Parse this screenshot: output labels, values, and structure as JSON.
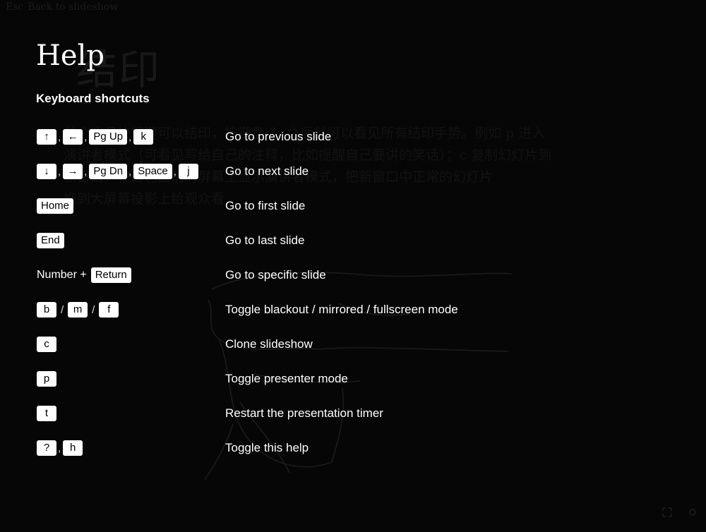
{
  "background": {
    "back_link": {
      "key": "Esc",
      "label": "Back to slideshow"
    },
    "slide_title": "结印",
    "slide_lines": [
      "单个字母快捷键可以结印，按键盘 ？ 之后就可以看见所有结印手势。例如 p 进入",
      "演讲者模式（可看见写给自己的注释，比如提醒自己要讲的笑话）；c 复制幻灯片到",
      "新窗口，在自己面前的屏幕上显示演讲者模式，把新窗口中正常的幻灯片",
      "拖到大屏幕投影上给观众看"
    ]
  },
  "help": {
    "title": "Help",
    "section_heading": "Keyboard shortcuts",
    "shortcuts": [
      {
        "keys": [
          "↑",
          "←",
          "Pg Up",
          "k"
        ],
        "description": "Go to previous slide"
      },
      {
        "keys": [
          "↓",
          "→",
          "Pg Dn",
          "Space",
          "j"
        ],
        "description": "Go to next slide"
      },
      {
        "keys": [
          "Home"
        ],
        "description": "Go to first slide"
      },
      {
        "keys": [
          "End"
        ],
        "description": "Go to last slide"
      },
      {
        "prefix": "Number +",
        "keys": [
          "Return"
        ],
        "description": "Go to specific slide"
      },
      {
        "keys": [
          "b",
          "m",
          "f"
        ],
        "description": "Toggle blackout / mirrored / fullscreen mode"
      },
      {
        "keys": [
          "c"
        ],
        "description": "Clone slideshow"
      },
      {
        "keys": [
          "p"
        ],
        "description": "Toggle presenter mode"
      },
      {
        "keys": [
          "t"
        ],
        "description": "Restart the presentation timer"
      },
      {
        "keys": [
          "?",
          "h"
        ],
        "description": "Toggle this help"
      }
    ],
    "separators": {
      "comma": ",",
      "slash": "/"
    }
  },
  "colors": {
    "background": "#060606",
    "text": "#ffffff",
    "key_background": "#ffffff",
    "key_text": "#000000"
  },
  "icons": [
    "fullscreen-icon",
    "settings-icon"
  ]
}
